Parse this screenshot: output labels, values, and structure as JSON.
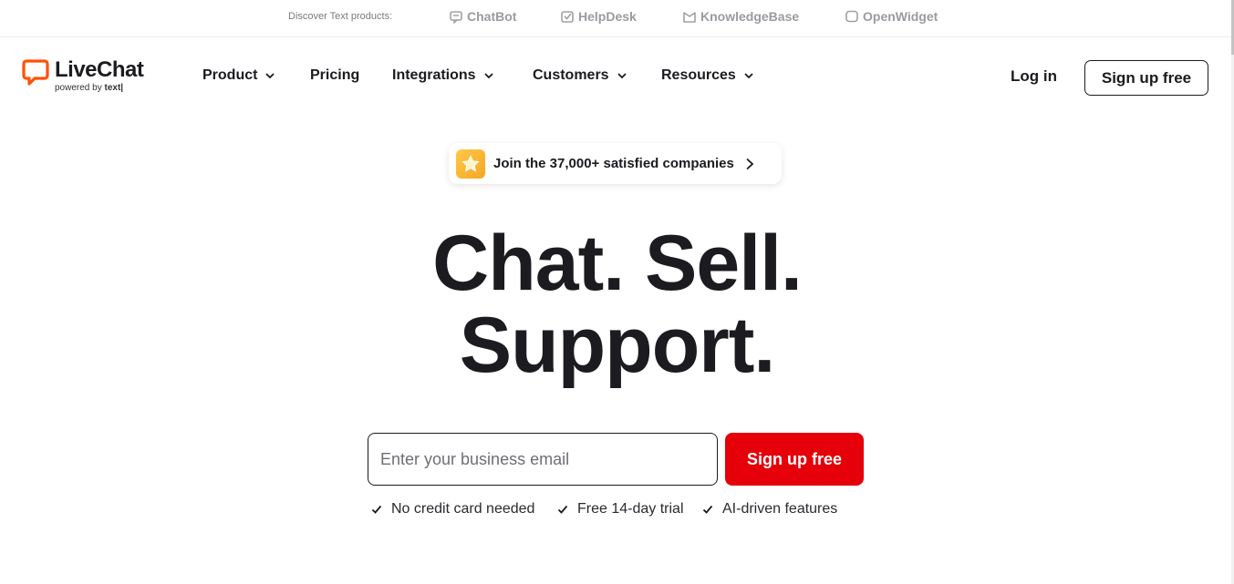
{
  "discover": {
    "label": "Discover Text products:",
    "products": [
      {
        "name": "ChatBot",
        "icon": "chatbot-icon"
      },
      {
        "name": "HelpDesk",
        "icon": "helpdesk-icon"
      },
      {
        "name": "KnowledgeBase",
        "icon": "knowledgebase-icon"
      },
      {
        "name": "OpenWidget",
        "icon": "openwidget-icon"
      }
    ]
  },
  "logo": {
    "name": "LiveChat",
    "sub_prefix": "powered by",
    "sub_brand": "text|",
    "accent": "#ff5100"
  },
  "nav": {
    "items": [
      {
        "label": "Product",
        "dropdown": true
      },
      {
        "label": "Pricing",
        "dropdown": false
      },
      {
        "label": "Integrations",
        "dropdown": true
      },
      {
        "label": "Customers",
        "dropdown": true
      },
      {
        "label": "Resources",
        "dropdown": true
      }
    ],
    "login": "Log in",
    "signup": "Sign up free"
  },
  "badge": {
    "text": "Join the 37,000+ satisfied companies",
    "icon": "star-icon"
  },
  "hero": {
    "line1": "Chat. Sell.",
    "line2": "Support."
  },
  "form": {
    "email_placeholder": "Enter your business email",
    "email_value": "",
    "submit": "Sign up free",
    "submit_color": "#e5000a"
  },
  "perks": [
    "No credit card needed",
    "Free 14-day trial",
    "AI-driven features"
  ]
}
